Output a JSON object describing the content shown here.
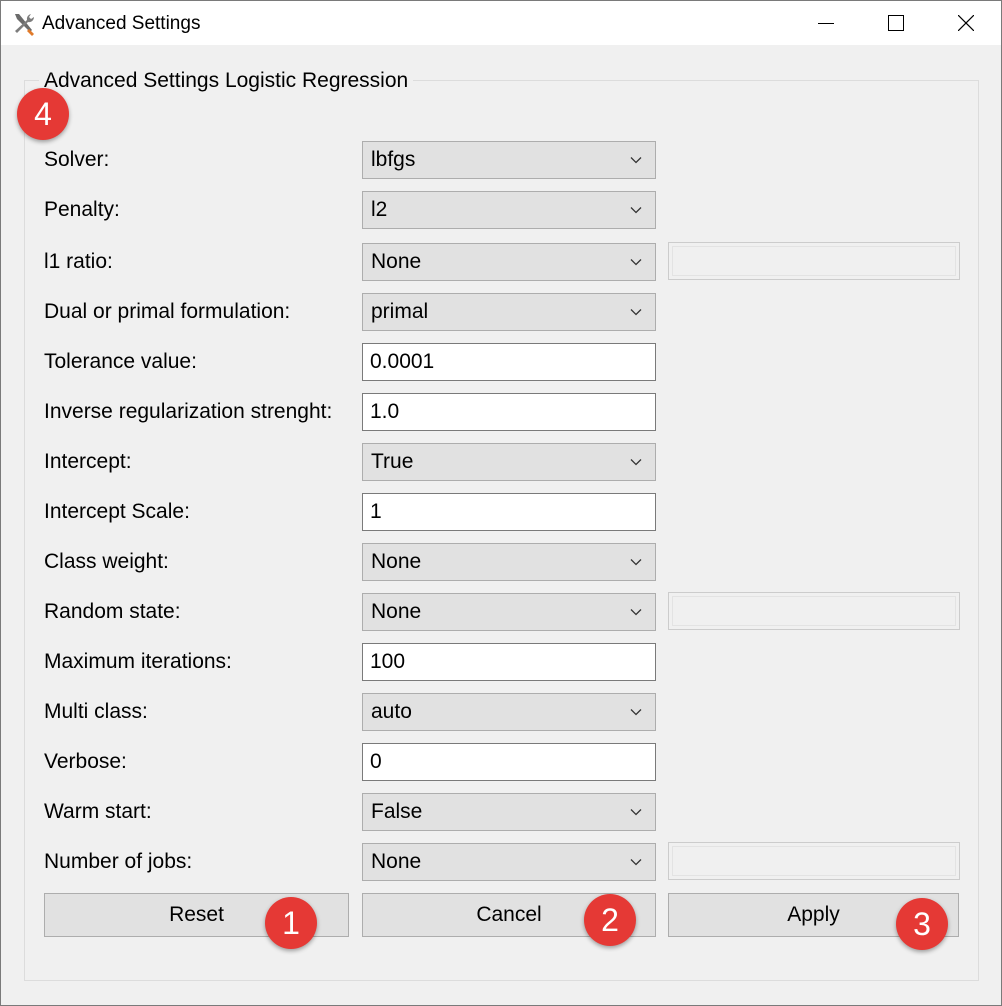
{
  "window": {
    "title": "Advanced Settings",
    "app_icon": "tools-icon",
    "controls": {
      "minimize_icon": "minimize-icon",
      "maximize_icon": "maximize-icon",
      "close_icon": "close-icon"
    }
  },
  "group": {
    "title": "Advanced Settings Logistic Regression"
  },
  "fields": {
    "solver": {
      "label": "Solver:",
      "value": "lbfgs"
    },
    "penalty": {
      "label": "Penalty:",
      "value": "l2"
    },
    "l1_ratio": {
      "label": "l1 ratio:",
      "value": "None",
      "extra_value": ""
    },
    "dual": {
      "label": "Dual or primal formulation:",
      "value": "primal"
    },
    "tolerance": {
      "label": "Tolerance value:",
      "value": "0.0001"
    },
    "inverse_reg": {
      "label": "Inverse regularization strenght:",
      "value": "1.0"
    },
    "intercept": {
      "label": "Intercept:",
      "value": "True"
    },
    "intercept_scale": {
      "label": "Intercept Scale:",
      "value": "1"
    },
    "class_weight": {
      "label": "Class weight:",
      "value": "None"
    },
    "random_state": {
      "label": "Random state:",
      "value": "None",
      "extra_value": ""
    },
    "max_iter": {
      "label": "Maximum iterations:",
      "value": "100"
    },
    "multi_class": {
      "label": "Multi class:",
      "value": "auto"
    },
    "verbose": {
      "label": "Verbose:",
      "value": "0"
    },
    "warm_start": {
      "label": "Warm start:",
      "value": "False"
    },
    "n_jobs": {
      "label": "Number of jobs:",
      "value": "None",
      "extra_value": ""
    }
  },
  "buttons": {
    "reset": "Reset",
    "cancel": "Cancel",
    "apply": "Apply"
  },
  "annotations": {
    "badge_1": "1",
    "badge_2": "2",
    "badge_3": "3",
    "badge_4": "4"
  },
  "colors": {
    "badge": "#e53935",
    "window_bg": "#f0f0f0",
    "control_bg": "#e1e1e1"
  }
}
